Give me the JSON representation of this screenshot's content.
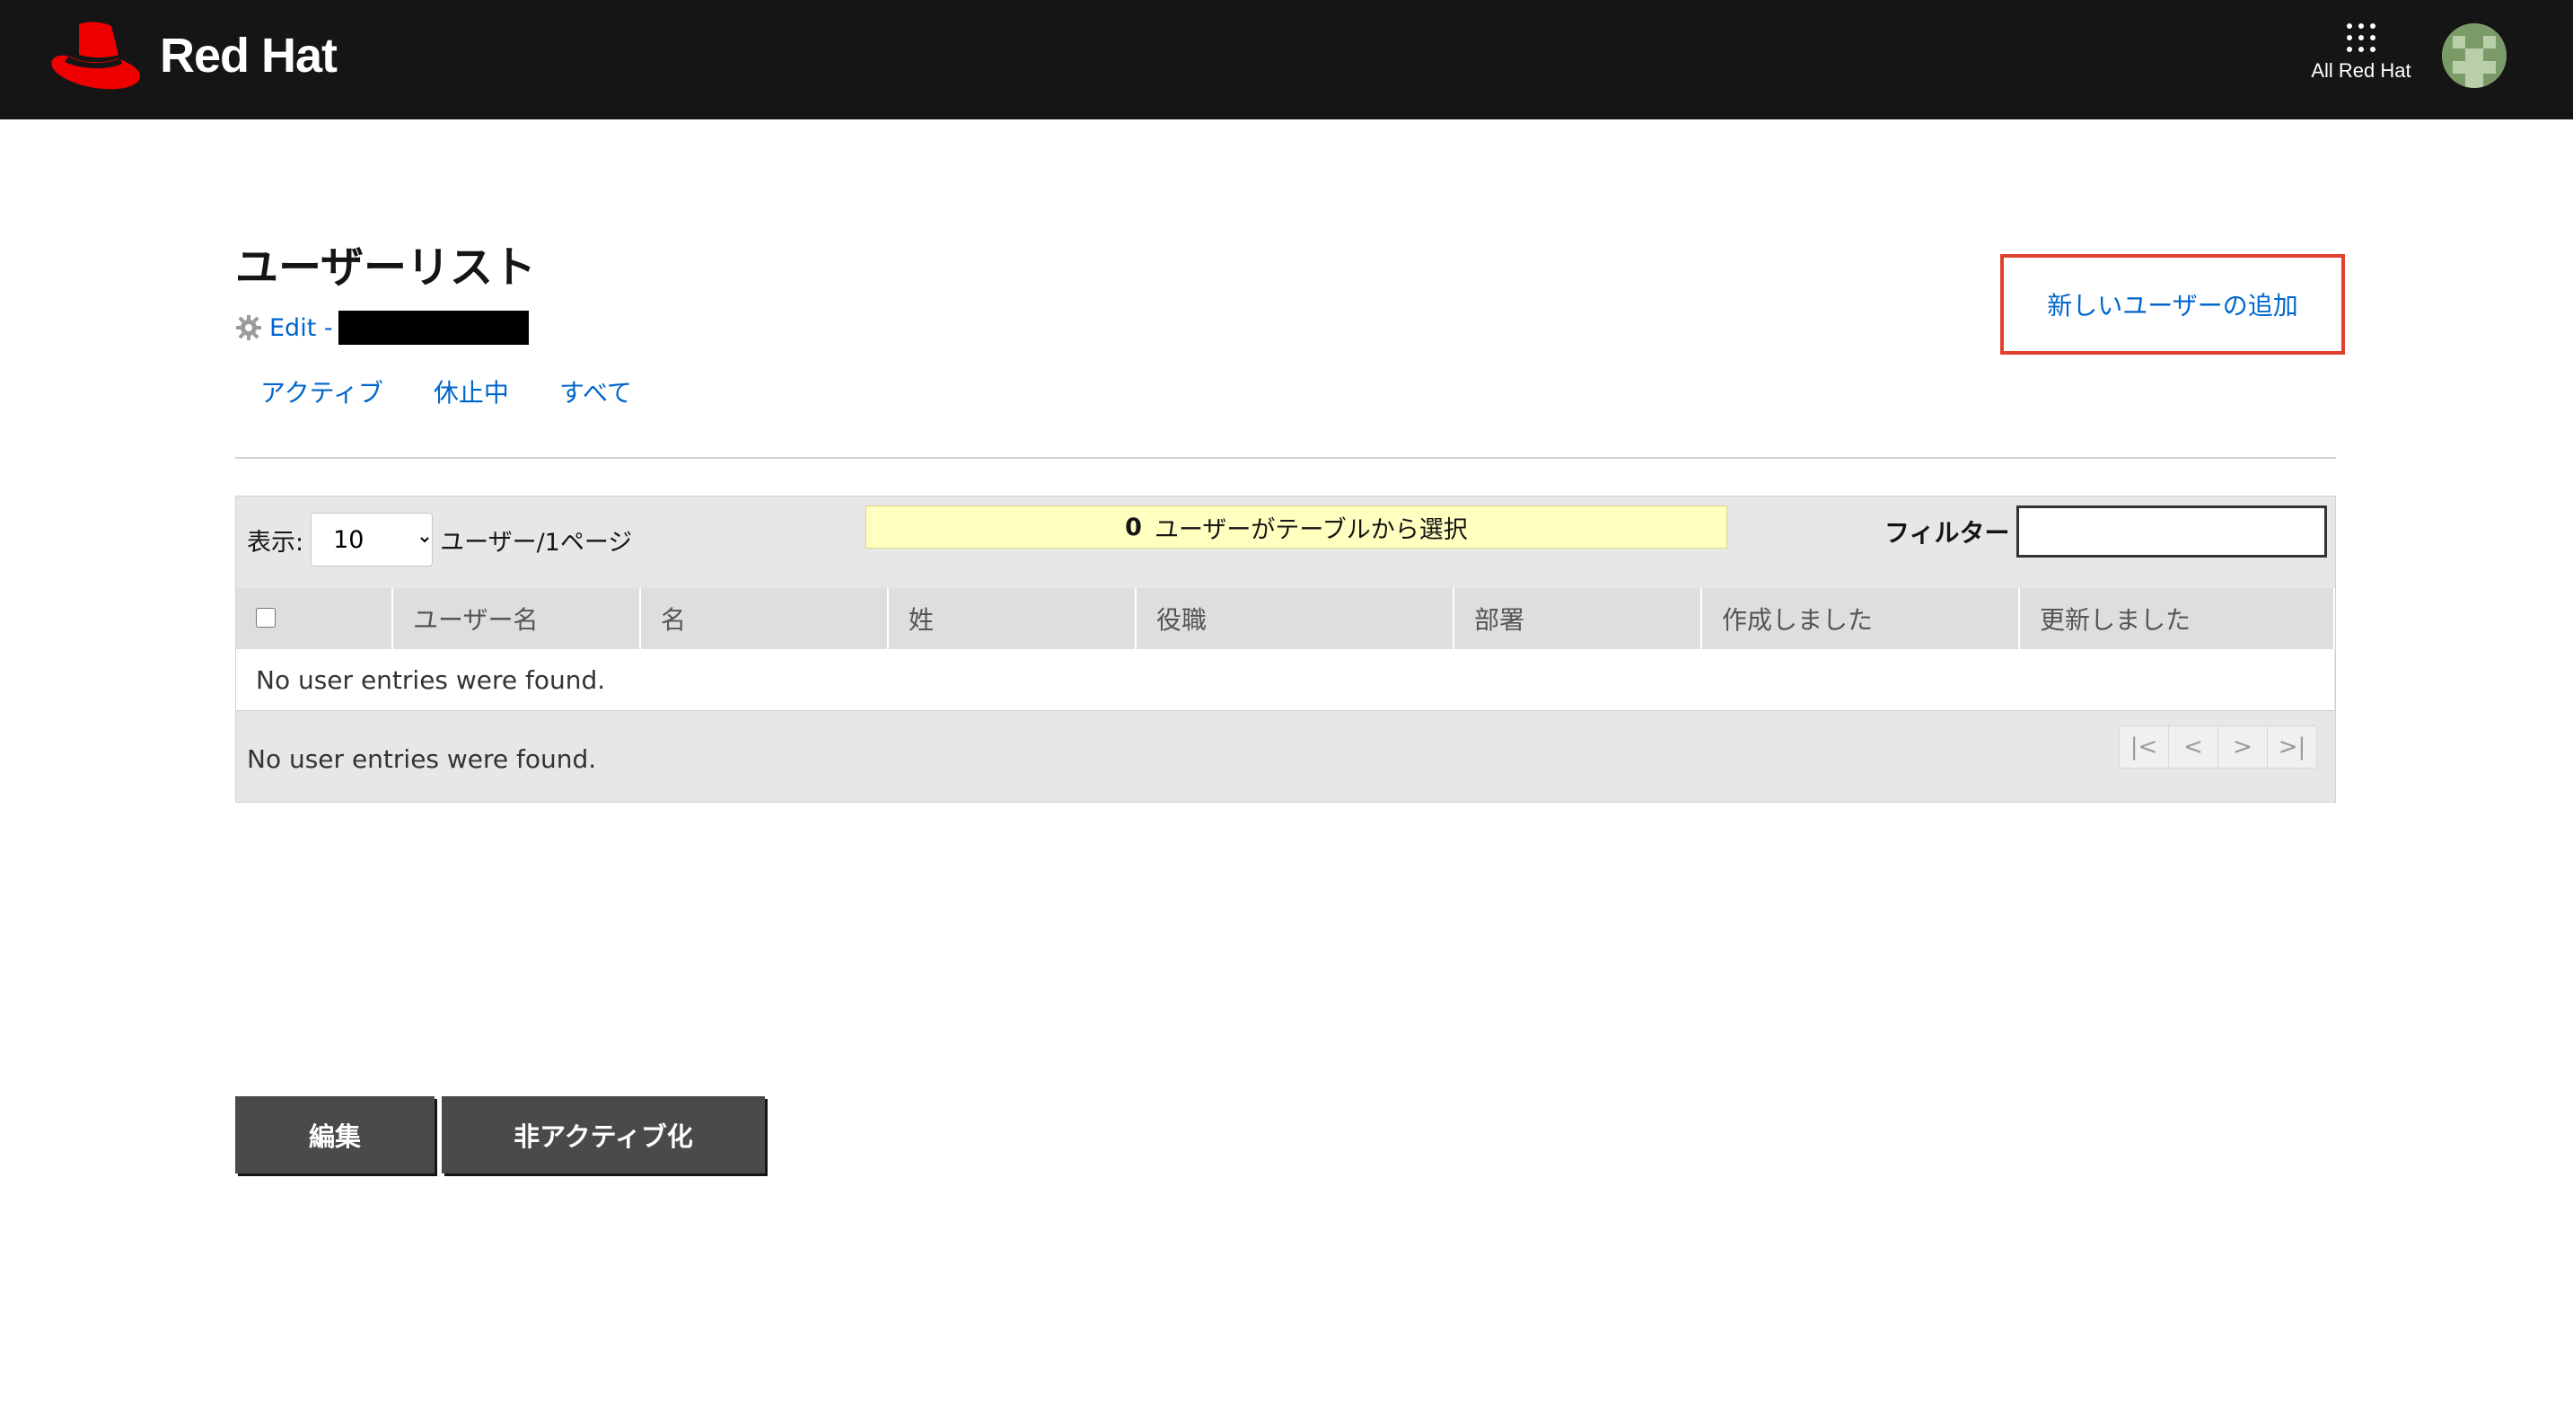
{
  "masthead": {
    "brand": "Red Hat",
    "apps_label": "All Red Hat"
  },
  "header": {
    "title": "ユーザーリスト",
    "edit_label": "Edit -",
    "add_user": "新しいユーザーの追加",
    "tabs": [
      "アクティブ",
      "休止中",
      "すべて"
    ]
  },
  "toolbar": {
    "show_label": "表示:",
    "per_page_value": "10",
    "per_page_suffix": "ユーザー/1ページ",
    "selected_count": "0",
    "selected_text": "ユーザーがテーブルから選択",
    "filter_label": "フィルター",
    "filter_value": ""
  },
  "table": {
    "columns": [
      "ユーザー名",
      "名",
      "姓",
      "役職",
      "部署",
      "作成しました",
      "更新しました"
    ],
    "empty_message": "No user entries were found."
  },
  "footer": {
    "status": "No user entries were found.",
    "pager": {
      "first": "|<",
      "prev": "<",
      "next": ">",
      "last": ">|"
    }
  },
  "actions": {
    "edit": "編集",
    "deactivate": "非アクティブ化"
  },
  "colors": {
    "masthead_bg": "#151515",
    "brand_red": "#ee0000",
    "link": "#0066cc",
    "highlight_border": "#e0412d",
    "banner_bg": "#ffffc0"
  }
}
